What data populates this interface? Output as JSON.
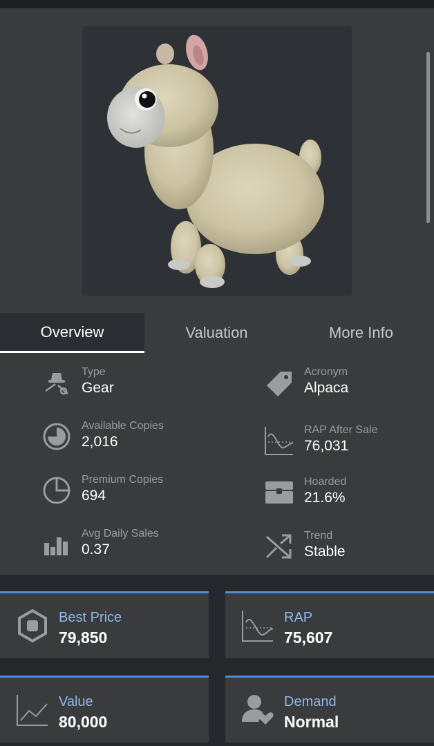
{
  "tabs": [
    {
      "label": "Overview",
      "active": true
    },
    {
      "label": "Valuation",
      "active": false
    },
    {
      "label": "More Info",
      "active": false
    }
  ],
  "stats": {
    "type": {
      "label": "Type",
      "value": "Gear",
      "icon": "hat-and-tools-icon"
    },
    "acronym": {
      "label": "Acronym",
      "value": "Alpaca",
      "icon": "tag-icon"
    },
    "available": {
      "label": "Available Copies",
      "value": "2,016",
      "icon": "pie-chart-icon"
    },
    "rap_after_sale": {
      "label": "RAP After Sale",
      "value": "76,031",
      "icon": "wave-chart-icon"
    },
    "premium": {
      "label": "Premium Copies",
      "value": "694",
      "icon": "pie-chart-outline-icon"
    },
    "hoarded": {
      "label": "Hoarded",
      "value": "21.6%",
      "icon": "chest-icon"
    },
    "avg_daily_sales": {
      "label": "Avg Daily Sales",
      "value": "0.37",
      "icon": "bar-chart-icon"
    },
    "trend": {
      "label": "Trend",
      "value": "Stable",
      "icon": "shuffle-icon"
    }
  },
  "cards": {
    "best_price": {
      "label": "Best Price",
      "value": "79,850",
      "icon": "robux-icon"
    },
    "rap": {
      "label": "RAP",
      "value": "75,607",
      "icon": "wave-chart-icon"
    },
    "value": {
      "label": "Value",
      "value": "80,000",
      "icon": "line-chart-icon"
    },
    "demand": {
      "label": "Demand",
      "value": "Normal",
      "icon": "user-heart-icon"
    }
  },
  "colors": {
    "accent": "#4d8fdc",
    "card_label": "#8fb8e8",
    "panel": "#393b3d",
    "background": "#24272b",
    "icon": "#9a9ca0"
  }
}
